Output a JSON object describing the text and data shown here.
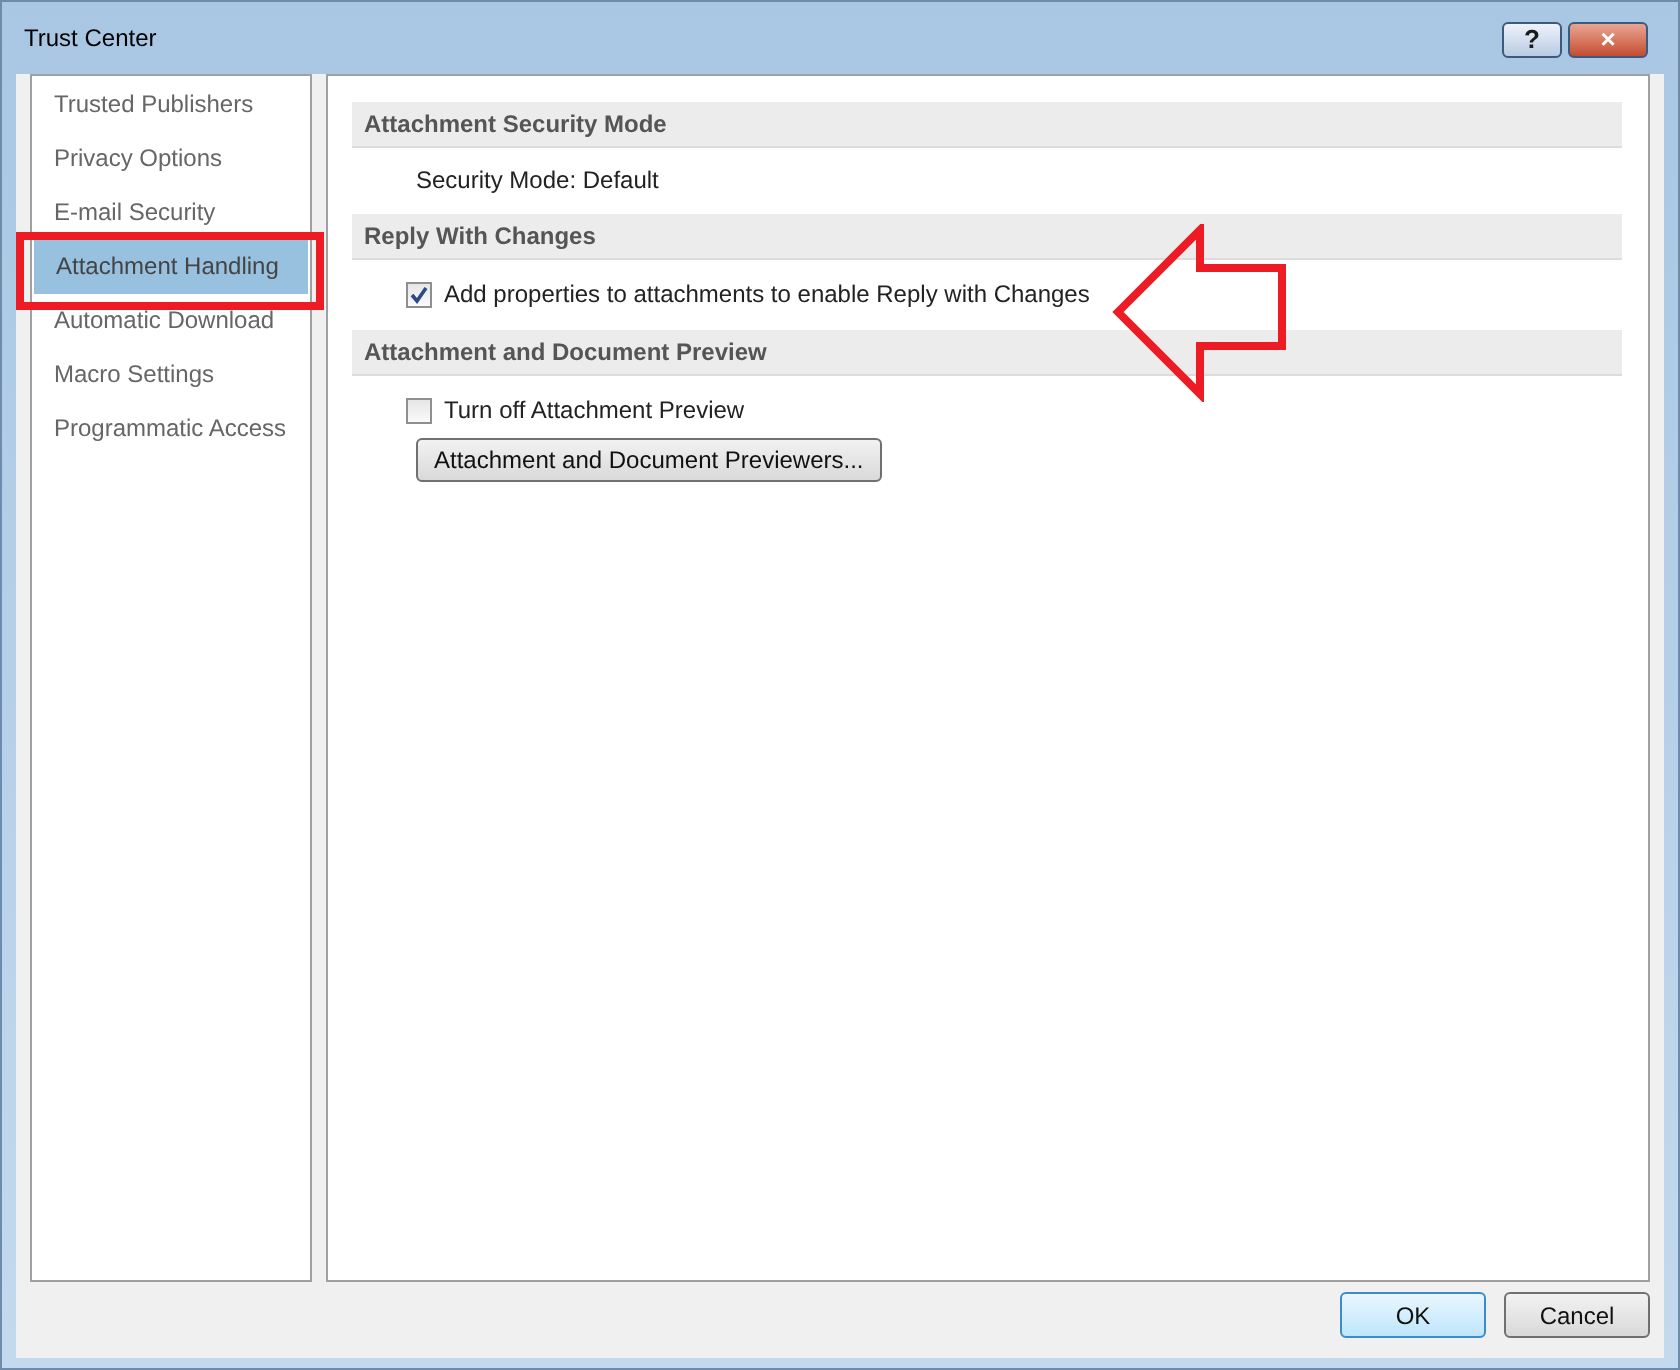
{
  "window": {
    "title": "Trust Center",
    "buttons": [
      "?",
      "×"
    ]
  },
  "sidebar": {
    "items": [
      {
        "label": "Trusted Publishers",
        "selected": false
      },
      {
        "label": "Privacy Options",
        "selected": false
      },
      {
        "label": "E-mail Security",
        "selected": false
      },
      {
        "label": "Attachment Handling",
        "selected": true
      },
      {
        "label": "Automatic Download",
        "selected": false
      },
      {
        "label": "Macro Settings",
        "selected": false
      },
      {
        "label": "Programmatic Access",
        "selected": false
      }
    ]
  },
  "sections": [
    {
      "title": "Attachment Security Mode",
      "items": [
        {
          "kind": "text",
          "label": "Security Mode: Default"
        }
      ]
    },
    {
      "title": "Reply With Changes",
      "items": [
        {
          "kind": "checkbox",
          "label": "Add properties to attachments to enable Reply with Changes",
          "checked": true
        }
      ]
    },
    {
      "title": "Attachment and Document Preview",
      "items": [
        {
          "kind": "checkbox",
          "label": "Turn off Attachment Preview",
          "checked": false
        },
        {
          "kind": "button",
          "label": "Attachment and Document Previewers..."
        }
      ]
    }
  ],
  "footer": {
    "buttons": [
      "OK",
      "Cancel"
    ]
  }
}
